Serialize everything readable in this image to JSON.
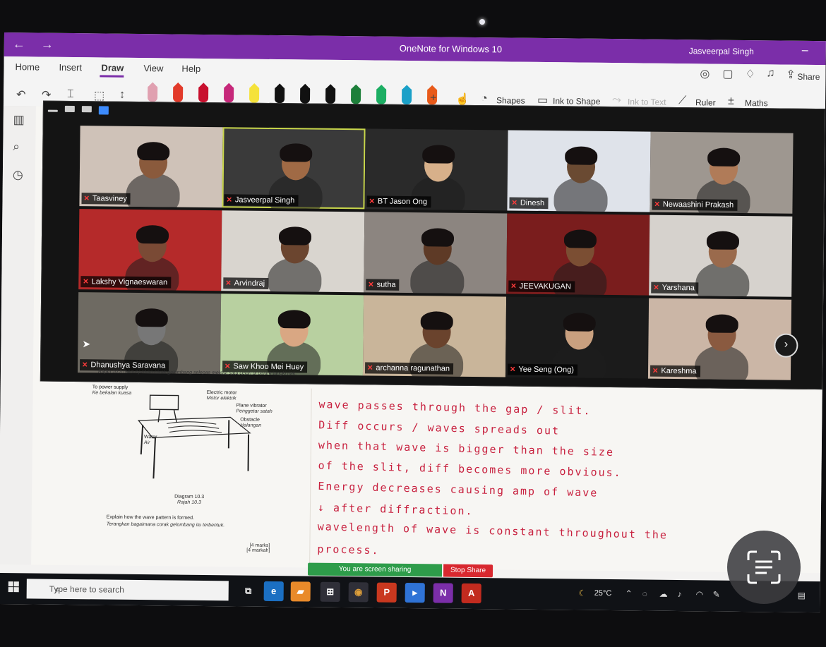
{
  "titlebar": {
    "title": "OneNote for Windows 10",
    "user": "Jasveerpal Singh",
    "back": "←",
    "forward": "→",
    "minimize": "–"
  },
  "ribbon": {
    "tabs": [
      "Home",
      "Insert",
      "Draw",
      "View",
      "Help"
    ],
    "active_tab": "Draw",
    "tools": {
      "shapes": "Shapes",
      "ink_to_shape": "Ink to Shape",
      "ink_to_text": "Ink to Text",
      "ruler": "Ruler",
      "maths": "Maths",
      "share": "Share"
    },
    "pen_colors": [
      "#e0a0b0",
      "#e23a2a",
      "#c8102e",
      "#c6287a",
      "#f5e23a",
      "#111111",
      "#111111",
      "#111111",
      "#1d7f3a",
      "#1cae63",
      "#1aa0c8",
      "#e85a1a"
    ]
  },
  "zoom": {
    "participants": [
      {
        "name": "Taasviney",
        "bg": "#cfc2b8",
        "skin": "#8a5a3c"
      },
      {
        "name": "Jasveerpal Singh",
        "bg": "#3a3a3a",
        "skin": "#a06a45",
        "speaking": true
      },
      {
        "name": "BT Jason Ong",
        "bg": "#2a2a2a",
        "skin": "#d7b08a"
      },
      {
        "name": "Dinesh",
        "bg": "#dfe3ea",
        "skin": "#6a4a32"
      },
      {
        "name": "Newaashini Prakash",
        "bg": "#9e9790",
        "skin": "#b07b58"
      },
      {
        "name": "Lakshy Vignaeswaran",
        "bg": "#b52a2a",
        "skin": "#7a4a35"
      },
      {
        "name": "Arvindraj",
        "bg": "#d9d5cf",
        "skin": "#6b452f"
      },
      {
        "name": "sutha",
        "bg": "#8c8580",
        "skin": "#5e3a26"
      },
      {
        "name": "JEEVAKUGAN",
        "bg": "#7a1d1d",
        "skin": "#7b4e33"
      },
      {
        "name": "Yarshana",
        "bg": "#d6d2cd",
        "skin": "#9a6a4c"
      },
      {
        "name": "Dhanushya Saravana",
        "bg": "#6e6a62",
        "skin": "#777777"
      },
      {
        "name": "Saw Khoo Mei Huey",
        "bg": "#b8d0a0",
        "skin": "#d9a783"
      },
      {
        "name": "archanna ragunathan",
        "bg": "#c9b59a",
        "skin": "#6a432d"
      },
      {
        "name": "Yee Seng (Ong)",
        "bg": "#1b1b1b",
        "skin": "#c9a07f"
      },
      {
        "name": "Kareshma",
        "bg": "#cbb6a6",
        "skin": "#8a5a40"
      }
    ]
  },
  "worksheet": {
    "intro": "Rajah 10.3 menunjukkan corak gelombang selepas melalui satu celah di dalam tangki riak.",
    "labels": [
      {
        "en": "To power supply",
        "ms": "Ke bekalan kuasa"
      },
      {
        "en": "Electric motor",
        "ms": "Motor elektrik"
      },
      {
        "en": "Plane vibrator",
        "ms": "Penggetar satah"
      },
      {
        "en": "Obstacle",
        "ms": "Halangan"
      },
      {
        "en": "Water",
        "ms": "Air"
      }
    ],
    "diagram": {
      "en": "Diagram 10.3",
      "ms": "Rajah 10.3"
    },
    "question": {
      "en": "Explain how the wave pattern is formed.",
      "ms": "Terangkan bagaimana corak gelombang itu terbentuk."
    },
    "marks": {
      "en": "[4 marks]",
      "ms": "[4 markah]"
    }
  },
  "notes": [
    "wave passes through the gap / slit.",
    "Diff occurs / waves spreads out",
    "when that wave is bigger than the size",
    "of the slit, diff becomes more obvious.",
    "Energy decreases causing amp of wave",
    "↓ after diffraction.",
    "wavelength of wave is constant throughout the",
    "process."
  ],
  "share_bar": {
    "status": "You are screen sharing",
    "stop": "Stop Share"
  },
  "taskbar": {
    "search_placeholder": "Type here to search",
    "temperature": "25°C"
  }
}
